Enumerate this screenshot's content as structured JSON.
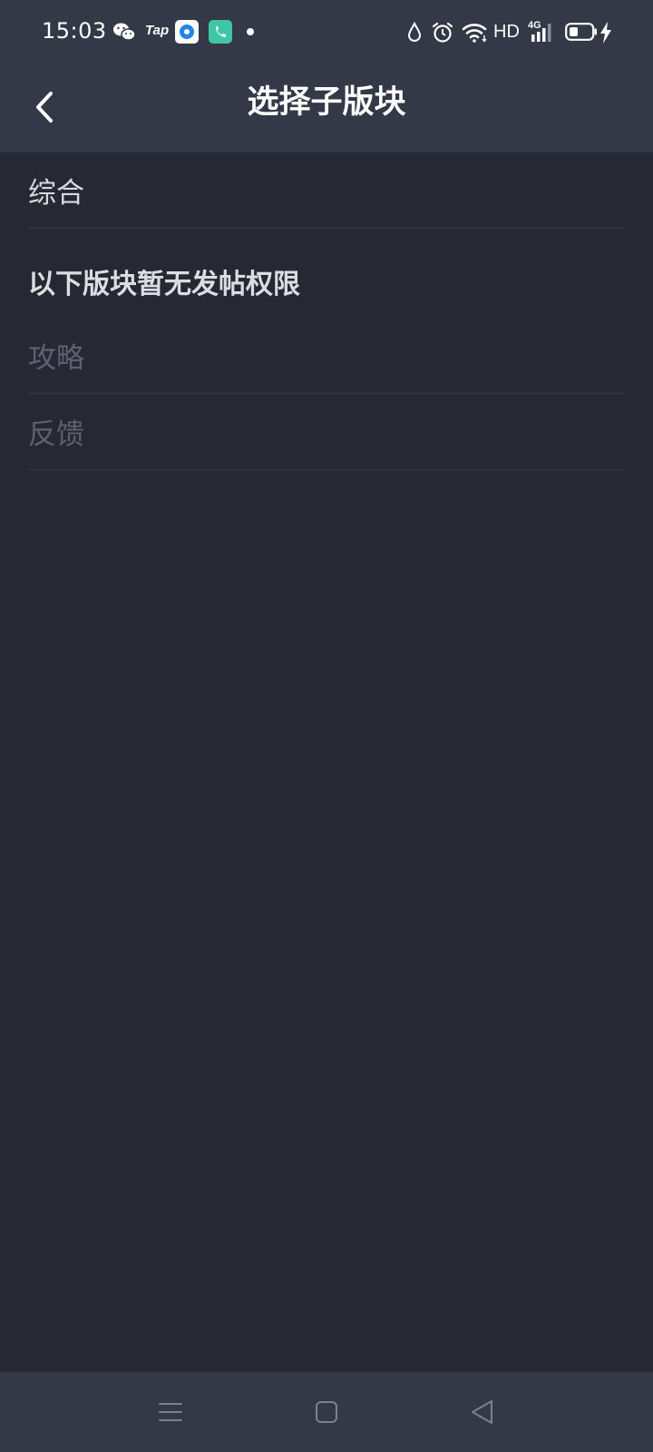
{
  "status_bar": {
    "time": "15:03",
    "tap_label": "Tap",
    "hd_label": "HD",
    "network_label": "4G",
    "icons": [
      "wechat-icon",
      "tap-icon",
      "browser-app-icon",
      "phone-app-icon",
      "notification-dot-icon",
      "water-drop-icon",
      "alarm-icon",
      "wifi-icon",
      "signal-icon",
      "battery-icon",
      "charging-icon"
    ]
  },
  "header": {
    "title": "选择子版块",
    "back_icon": "chevron-left-icon"
  },
  "boards": {
    "available": [
      {
        "label": "综合"
      }
    ],
    "restricted_heading": "以下版块暂无发帖权限",
    "restricted": [
      {
        "label": "攻略"
      },
      {
        "label": "反馈"
      }
    ]
  },
  "nav_bar": {
    "icons": [
      "menu-icon",
      "home-icon",
      "back-triangle-icon"
    ]
  },
  "colors": {
    "background": "#262833",
    "bar_background": "#333947",
    "text_primary": "#d8d9de",
    "text_disabled": "#5e6170",
    "divider": "#363945"
  }
}
